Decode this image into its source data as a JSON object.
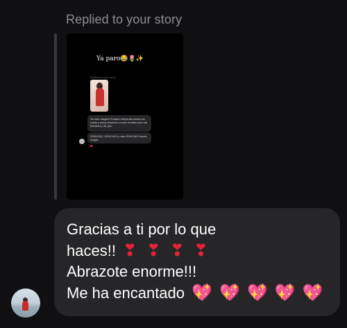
{
  "reply_header": {
    "label": "Replied to your story"
  },
  "story": {
    "caption": "Ya paro😂🌷✨",
    "mini_replied_label": "Replied to your story",
    "mini_messages": [
      "He sido magia!!! Estaba releyendo ahora los notas y estoy llorando a moco tendido pero de felicidad y de paz.",
      "GRACIAS, GRACIAS y más GRACIAS Hacés magia."
    ],
    "mini_reaction": "❤"
  },
  "message": {
    "lines": [
      "Gracias a ti por lo que",
      "haces!!",
      "Abrazote enorme!!!",
      "Me ha encantado"
    ],
    "line2_emojis": [
      "❣",
      "❣",
      "❣",
      "❣"
    ],
    "line4_emojis": [
      "💖",
      "💖",
      "💖",
      "💖",
      "💖"
    ]
  },
  "colors": {
    "background": "#101013",
    "bubble": "#262629",
    "label": "#8e8e93",
    "heart": "#e6223a",
    "sparkle_heart": "#f2559f"
  },
  "icons": {
    "heart_exclamation": "heavy-heart-exclamation",
    "sparkling_heart": "sparkling-heart"
  }
}
